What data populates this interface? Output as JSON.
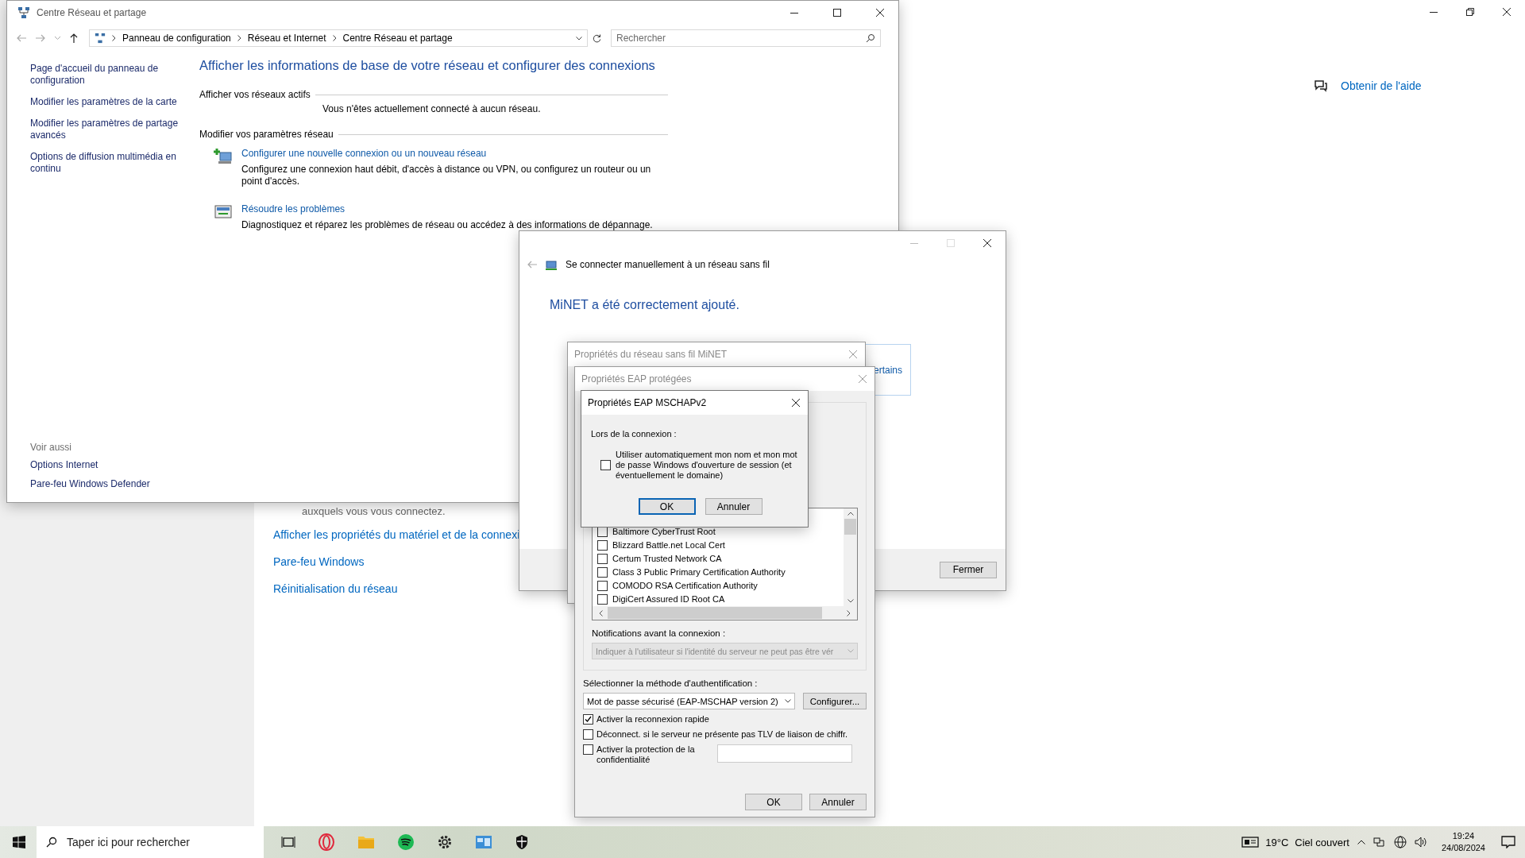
{
  "background_window": {
    "help_link": "Obtenir de l'aide",
    "text": "auxquels vous vous connectez.",
    "links": [
      "Afficher les propriétés du matériel et de la connexi",
      "Pare-feu Windows",
      "Réinitialisation du réseau"
    ]
  },
  "main_window": {
    "title": "Centre Réseau et partage",
    "breadcrumb": [
      "Panneau de configuration",
      "Réseau et Internet",
      "Centre Réseau et partage"
    ],
    "search_placeholder": "Rechercher",
    "sidebar": [
      "Page d'accueil du panneau de configuration",
      "Modifier les paramètres de la carte",
      "Modifier les paramètres de partage avancés",
      "Options de diffusion multimédia en continu"
    ],
    "see_also_title": "Voir aussi",
    "see_also": [
      "Options Internet",
      "Pare-feu Windows Defender"
    ],
    "heading": "Afficher les informations de base de votre réseau et configurer des connexions",
    "active_networks": {
      "label": "Afficher vos réseaux actifs",
      "message": "Vous n'êtes actuellement connecté à aucun réseau."
    },
    "settings": {
      "label": "Modifier vos paramètres réseau",
      "items": [
        {
          "kind": "new",
          "title": "Configurer une nouvelle connexion ou un nouveau réseau",
          "description": "Configurez une connexion haut débit, d'accès à distance ou VPN, ou configurez un routeur ou un point d'accès."
        },
        {
          "kind": "troubleshoot",
          "title": "Résoudre les problèmes",
          "description": "Diagnostiquez et réparez les problèmes de réseau ou accédez à des informations de dépannage."
        }
      ]
    }
  },
  "wizard": {
    "title": "Se connecter manuellement à un réseau sans fil",
    "heading": "MiNET a été correctement ajouté.",
    "partial_link": "ertains",
    "close_button": "Fermer"
  },
  "wireless_dialog": {
    "title": "Propriétés du réseau sans fil MiNET"
  },
  "eap_dialog": {
    "title": "Propriétés EAP protégées",
    "certificates": [
      {
        "label": "Baltimore CyberTrust Root",
        "checked": false
      },
      {
        "label": "Blizzard Battle.net Local Cert",
        "checked": false
      },
      {
        "label": "Certum Trusted Network CA",
        "checked": false
      },
      {
        "label": "Class 3 Public Primary Certification Authority",
        "checked": false
      },
      {
        "label": "COMODO RSA Certification Authority",
        "checked": false
      },
      {
        "label": "DigiCert Assured ID Root CA",
        "checked": false
      }
    ],
    "notifications_label": "Notifications avant la connexion :",
    "notifications_value": "Indiquer à l'utilisateur si l'identité du serveur ne peut pas être vér",
    "auth_label": "Sélectionner la méthode d'authentification :",
    "auth_value": "Mot de passe sécurisé (EAP-MSCHAP version 2)",
    "configure_button": "Configurer...",
    "options": [
      {
        "label": "Activer la reconnexion rapide",
        "checked": true
      },
      {
        "label": "Déconnect. si le serveur ne présente pas TLV de liaison de chiffr.",
        "checked": false
      },
      {
        "label": "Activer la protection de la confidentialité",
        "checked": false
      }
    ],
    "ok": "OK",
    "cancel": "Annuler"
  },
  "mschap_dialog": {
    "title": "Propriétés EAP MSCHAPv2",
    "group_label": "Lors de la connexion :",
    "option": {
      "label": "Utiliser automatiquement mon nom et mon mot de passe Windows d'ouverture de session (et éventuellement le domaine)",
      "checked": false
    },
    "ok": "OK",
    "cancel": "Annuler"
  },
  "taskbar": {
    "search_placeholder": "Taper ici pour rechercher",
    "temperature": "19°C",
    "weather": "Ciel couvert",
    "time": "19:24",
    "date": "24/08/2024"
  }
}
